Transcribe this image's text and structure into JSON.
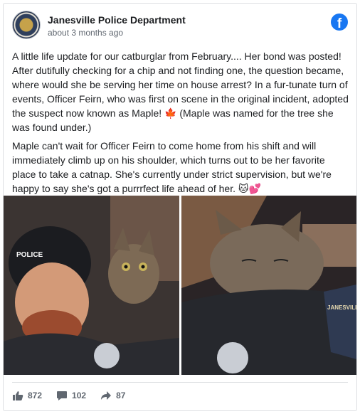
{
  "post": {
    "page_name": "Janesville Police Department",
    "time": "about 3 months ago",
    "paragraphs": [
      "A little life update for our catburglar from February.... Her bond was posted! After dutifully checking for a chip and not finding one, the question became, where would she be serving her time on house arrest? In a fur-tunate turn of events, Officer Feirn, who was first on scene in the original incident, adopted the suspect now known as Maple! 🍁 (Maple was named for the tree she was found under.)",
      "Maple can't wait for Officer Feirn to come home from his shift and will immediately climb up on his shoulder, which turns out to be her favorite place to take a catnap. She's currently under strict supervision, but we're happy to say she's got a purrrfect life ahead of her. 🐱💕"
    ],
    "fb_logo_letter": "f"
  },
  "photos": {
    "left_badge_text": "POLICE",
    "right_patch_text": "JANESVILLE"
  },
  "engagement": {
    "likes": "872",
    "comments": "102",
    "shares": "87"
  },
  "colors": {
    "facebook_blue": "#1877f2",
    "secondary_text": "#606770"
  }
}
